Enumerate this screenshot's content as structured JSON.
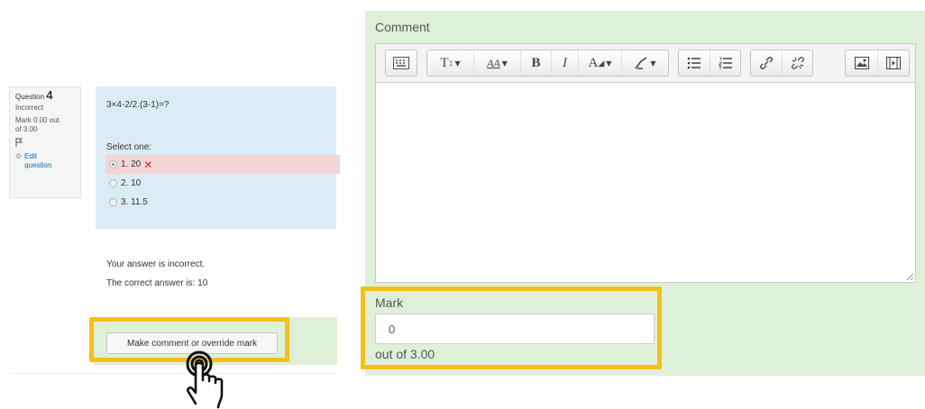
{
  "question": {
    "label": "Question",
    "number": "4",
    "state": "Incorrect",
    "mark_line1": "Mark 0.00 out",
    "mark_line2": "of 3.00",
    "edit_line1": "Edit",
    "edit_line2": "question",
    "text": "3×4-2/2.(3-1)=?",
    "select_prompt": "Select one:",
    "options": [
      {
        "label": "1. 20",
        "checked": true,
        "wrong": true
      },
      {
        "label": "2. 10",
        "checked": false,
        "wrong": false
      },
      {
        "label": "3. 11.5",
        "checked": false,
        "wrong": false
      }
    ],
    "feedback_incorrect": "Your answer is incorrect.",
    "correct_answer": "The correct answer is: 10",
    "override_button": "Make comment or override mark"
  },
  "grading": {
    "comment_label": "Comment",
    "mark_label": "Mark",
    "mark_value": "0",
    "out_of": "out of 3.00"
  },
  "colors": {
    "highlight": "#f2c21a",
    "question_bg": "#dcecf6",
    "comment_bg": "#dff0d8",
    "wrong_bg": "#f3d5d6",
    "wrong_mark": "#e02a1d"
  },
  "toolbar_icons": [
    "show-more-buttons-icon",
    "paragraph-styles-icon",
    "font-size-icon",
    "bold-icon",
    "italic-icon",
    "font-color-icon",
    "background-color-icon",
    "unordered-list-icon",
    "ordered-list-icon",
    "link-icon",
    "unlink-icon",
    "insert-image-icon",
    "insert-media-icon"
  ]
}
